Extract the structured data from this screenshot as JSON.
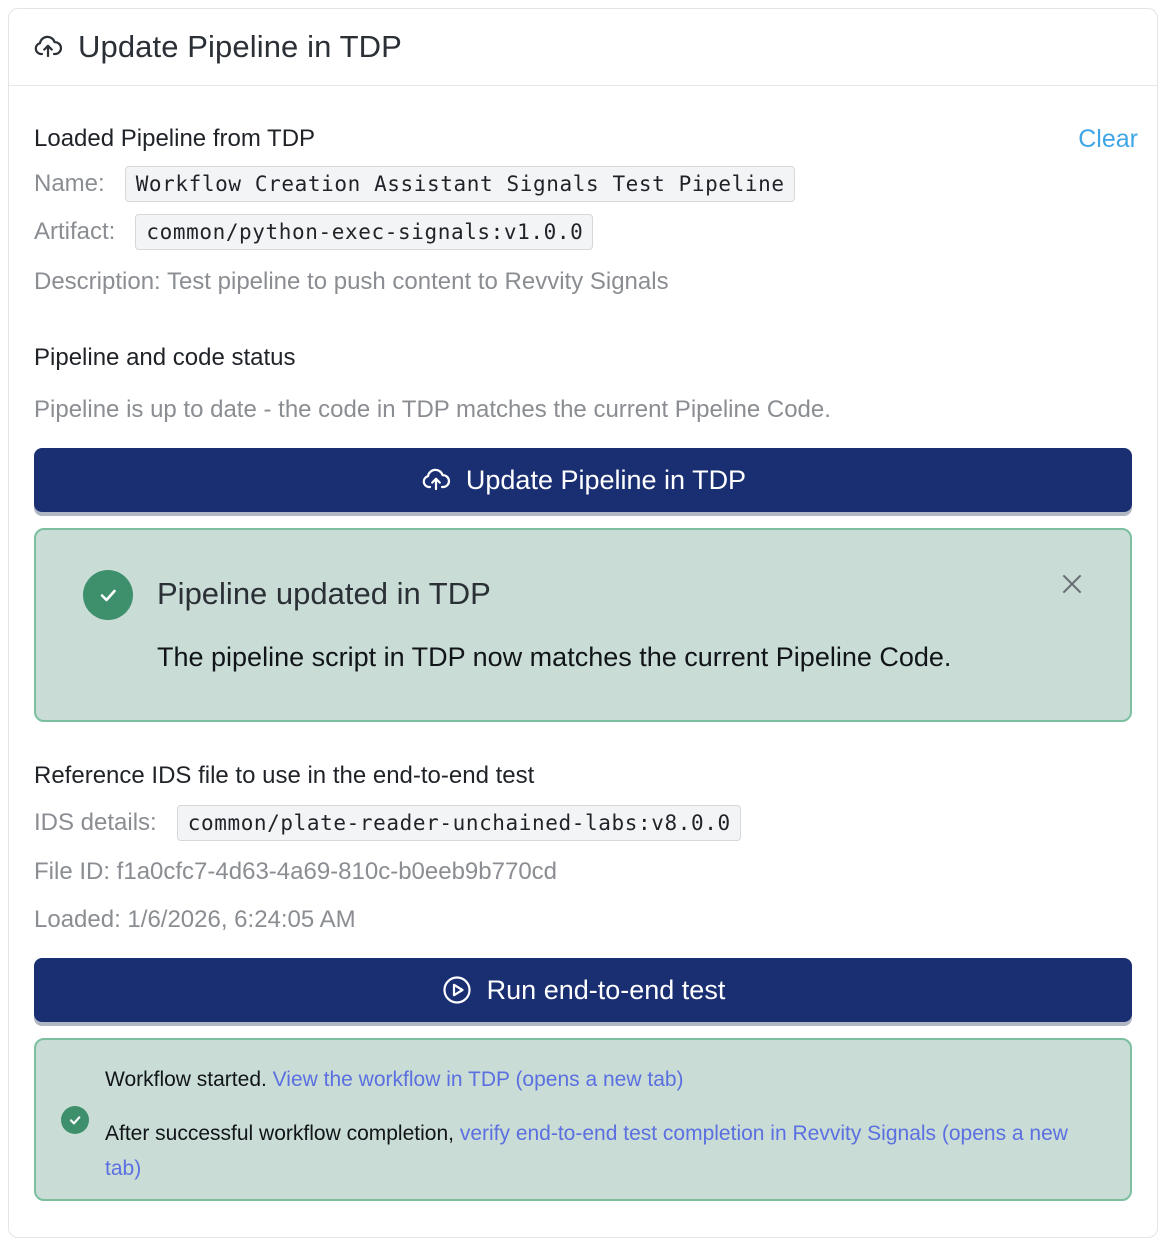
{
  "header": {
    "icon": "cloud-upload-icon",
    "title": "Update Pipeline in TDP"
  },
  "loaded": {
    "title": "Loaded Pipeline from TDP",
    "clear_label": "Clear",
    "name_label": "Name:",
    "name_value": "Workflow Creation Assistant Signals Test Pipeline",
    "artifact_label": "Artifact:",
    "artifact_value": "common/python-exec-signals:v1.0.0",
    "description": "Description: Test pipeline to push content to Revvity Signals"
  },
  "status": {
    "title": "Pipeline and code status",
    "message": "Pipeline is up to date - the code in TDP matches the current Pipeline Code.",
    "update_button_label": "Update Pipeline in TDP",
    "update_button_icon": "cloud-upload-icon"
  },
  "update_alert": {
    "icon": "check-circle-icon",
    "title": "Pipeline updated in TDP",
    "body": "The pipeline script in TDP now matches the current Pipeline Code.",
    "close_icon": "close-icon"
  },
  "reference": {
    "title": "Reference IDS file to use in the end-to-end test",
    "ids_label": "IDS details:",
    "ids_value": "common/plate-reader-unchained-labs:v8.0.0",
    "file_id": "File ID: f1a0cfc7-4d63-4a69-810c-b0eeb9b770cd",
    "loaded": "Loaded: 1/6/2026, 6:24:05 AM",
    "run_button_label": "Run end-to-end test",
    "run_button_icon": "play-circle-icon"
  },
  "run_alert": {
    "icon": "check-circle-icon",
    "line1_text": "Workflow started.",
    "line1_link": "View the workflow in TDP (opens a new tab)",
    "line2_text": "After successful workflow completion,",
    "line2_link": "verify end-to-end test completion in Revvity Signals (opens a new tab)"
  },
  "colors": {
    "primary": "#1a2f72",
    "success_bg": "#c9ddd6",
    "success_border": "#7bbf9f",
    "success_icon": "#3e8f6c",
    "link": "#5b6fe0",
    "clear_link": "#3fa6e6"
  }
}
